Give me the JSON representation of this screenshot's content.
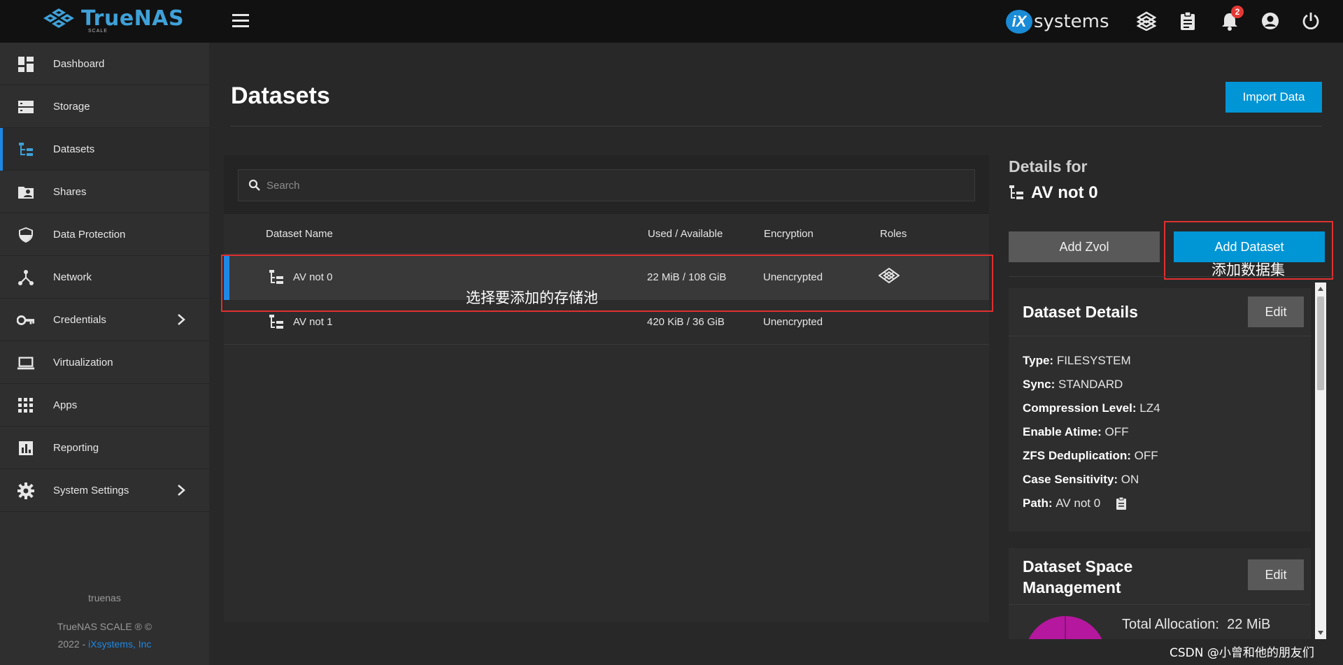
{
  "app": {
    "logo_text": "TrueNAS",
    "logo_sub": "SCALE",
    "vendor": "iX",
    "vendor_text": "systems",
    "notifications_count": "2"
  },
  "sidebar": {
    "items": [
      {
        "label": "Dashboard",
        "icon": "dashboard-icon"
      },
      {
        "label": "Storage",
        "icon": "storage-icon"
      },
      {
        "label": "Datasets",
        "icon": "datasets-icon",
        "active": true
      },
      {
        "label": "Shares",
        "icon": "shares-icon"
      },
      {
        "label": "Data Protection",
        "icon": "shield-icon"
      },
      {
        "label": "Network",
        "icon": "network-icon"
      },
      {
        "label": "Credentials",
        "icon": "key-icon",
        "expandable": true
      },
      {
        "label": "Virtualization",
        "icon": "laptop-icon"
      },
      {
        "label": "Apps",
        "icon": "apps-grid-icon"
      },
      {
        "label": "Reporting",
        "icon": "reporting-icon"
      },
      {
        "label": "System Settings",
        "icon": "gear-icon",
        "expandable": true
      }
    ],
    "hostname": "truenas",
    "copyright_line1": "TrueNAS SCALE ® ©",
    "copyright_year": "2022 -",
    "copyright_link": "iXsystems, Inc"
  },
  "main": {
    "title": "Datasets",
    "import_label": "Import Data",
    "search_placeholder": "Search",
    "columns": {
      "name": "Dataset Name",
      "used": "Used / Available",
      "encryption": "Encryption",
      "roles": "Roles"
    },
    "rows": [
      {
        "name": "AV not 0",
        "used": "22 MiB / 108 GiB",
        "encryption": "Unencrypted"
      },
      {
        "name": "AV not 1",
        "used": "420 KiB / 36 GiB",
        "encryption": "Unencrypted"
      }
    ],
    "note_select_pool": "选择要添加的存储池"
  },
  "details": {
    "heading": "Details for",
    "name": "AV not 0",
    "add_zvol": "Add Zvol",
    "add_dataset": "Add Dataset",
    "note_add_dataset": "添加数据集",
    "dataset_details": {
      "title": "Dataset Details",
      "edit": "Edit",
      "type_k": "Type:",
      "type_v": "FILESYSTEM",
      "sync_k": "Sync:",
      "sync_v": "STANDARD",
      "compression_k": "Compression Level:",
      "compression_v": "LZ4",
      "atime_k": "Enable Atime:",
      "atime_v": "OFF",
      "dedup_k": "ZFS Deduplication:",
      "dedup_v": "OFF",
      "case_k": "Case Sensitivity:",
      "case_v": "ON",
      "path_k": "Path:",
      "path_v": "AV not 0"
    },
    "space": {
      "title_line1": "Dataset Space",
      "title_line2": "Management",
      "edit": "Edit",
      "total_k": "Total Allocation:",
      "total_v": "22 MiB"
    }
  },
  "watermark": "CSDN @小曾和他的朋友们",
  "colors": {
    "accent": "#0095d5",
    "highlight_box": "#e03030",
    "chart": "#b5179e"
  }
}
